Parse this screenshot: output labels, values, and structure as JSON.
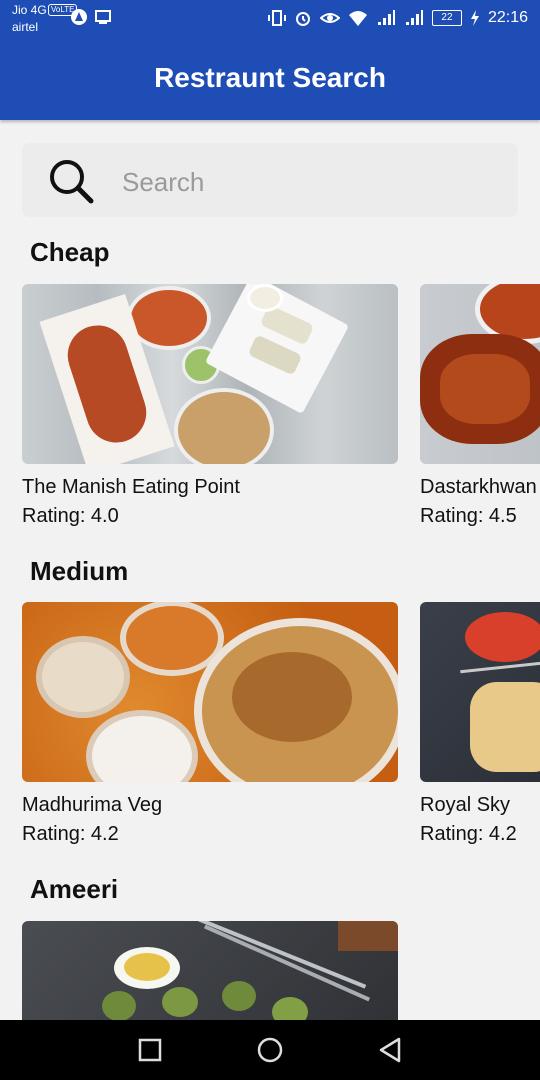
{
  "status": {
    "carrier1": "Jio 4G",
    "volte": "VoLTE",
    "carrier2": "airtel",
    "battery": "22",
    "time": "22:16"
  },
  "app": {
    "title": "Restraunt Search"
  },
  "search": {
    "placeholder": "Search"
  },
  "sections": [
    {
      "title": "Cheap",
      "cards": [
        {
          "name": "The Manish Eating Point",
          "rating": "Rating: 4.0"
        },
        {
          "name": "Dastarkhwan",
          "rating": "Rating: 4.5"
        }
      ]
    },
    {
      "title": "Medium",
      "cards": [
        {
          "name": "Madhurima Veg",
          "rating": "Rating: 4.2"
        },
        {
          "name": "Royal Sky",
          "rating": "Rating: 4.2"
        }
      ]
    },
    {
      "title": "Ameeri",
      "cards": [
        {
          "name": "",
          "rating": ""
        }
      ]
    }
  ],
  "colors": {
    "primary": "#1e4db6",
    "background": "#f2f2f2",
    "nav": "#000000"
  }
}
